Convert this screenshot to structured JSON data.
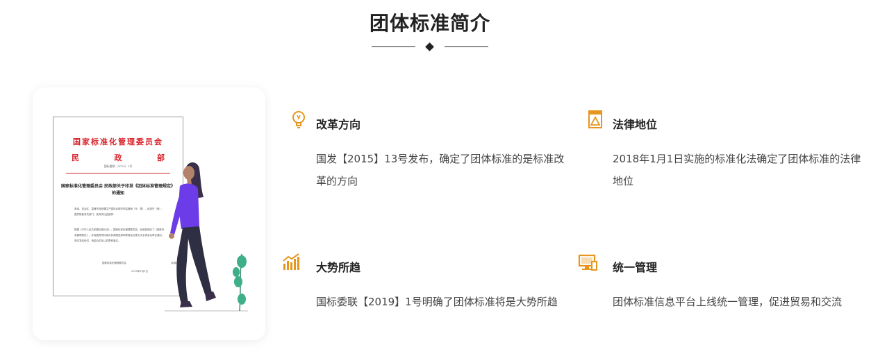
{
  "section": {
    "title": "团体标准简介"
  },
  "document": {
    "org_line1": "国家标准化管理委员会",
    "org_line2_left": "民",
    "org_line2_mid": "政",
    "org_line2_right": "部",
    "doc_no": "国标委联〔2019〕1号",
    "doc_title": "国家标准化管理委员会 民政部关于印发《团体标准管理规定》的通知",
    "para1": "各省、自治区、直辖市及新疆生产建设兵团市场监管局（厅、委）、民政厅（局），国务院各有关部门，各有关社会团体：",
    "para2": "根据《中华人民共和国标准化法》，国家标准化管理委员会、民政部制定了《团体标准管理规定》，并经国务院标准化协调推进部际联席会议第五次全体会议审议通过，现印发给你们，请结合实际认真贯彻落实。",
    "signature_left": "国家标准化管理委员会",
    "signature_right": "民政部",
    "date": "2019年1月9日"
  },
  "colors": {
    "accent": "#e6951d",
    "title": "#222222",
    "doc_red": "#d9232b",
    "figure_purple": "#6c3ce9"
  },
  "features": [
    {
      "icon": "lightbulb-icon",
      "title": "改革方向",
      "desc": "国发【2015】13号发布，确定了团体标准的是标准改革的方向"
    },
    {
      "icon": "framed-picture-icon",
      "title": "法律地位",
      "desc": "2018年1月1日实施的标准化法确定了团体标准的法律地位"
    },
    {
      "icon": "bar-chart-icon",
      "title": "大势所趋",
      "desc": "国标委联【2019】1号明确了团体标准将是大势所趋"
    },
    {
      "icon": "computer-icon",
      "title": "统一管理",
      "desc": "团体标准信息平台上线统一管理，促进贸易和交流"
    }
  ]
}
